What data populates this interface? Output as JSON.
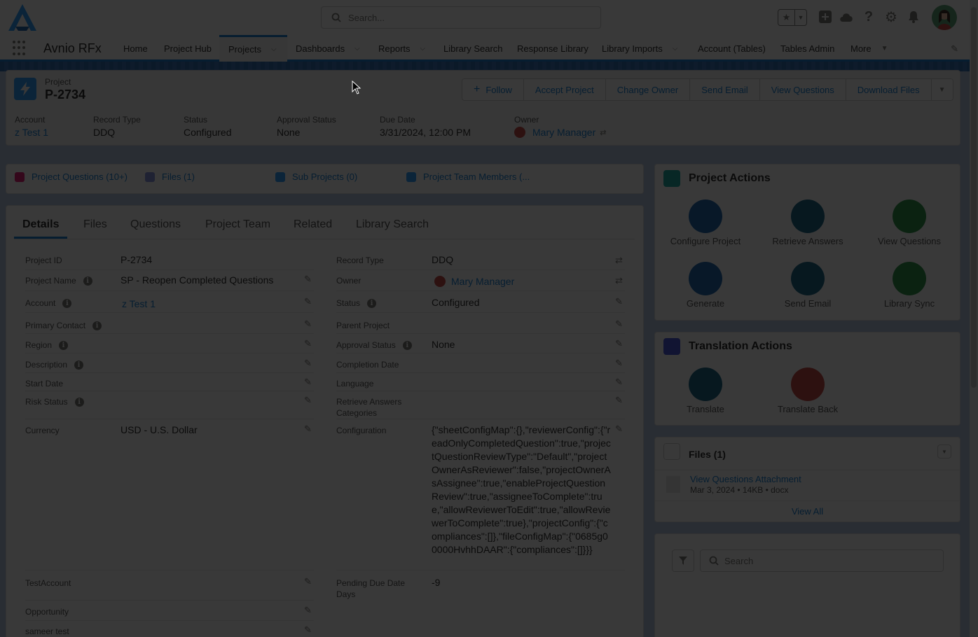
{
  "header": {
    "search_placeholder": "Search...",
    "app_name": "Avnio RFx"
  },
  "nav": {
    "items": [
      {
        "label": "Home"
      },
      {
        "label": "Project Hub"
      },
      {
        "label": "Projects",
        "active": true,
        "dropdown": true
      },
      {
        "label": "Dashboards",
        "dropdown": true
      },
      {
        "label": "Reports",
        "dropdown": true
      },
      {
        "label": "Library Search"
      },
      {
        "label": "Response Library"
      },
      {
        "label": "Library Imports",
        "dropdown": true
      },
      {
        "label": "Account (Tables)"
      },
      {
        "label": "Tables Admin"
      },
      {
        "label": "More",
        "dropdown": true
      }
    ]
  },
  "record": {
    "type_label": "Project",
    "name": "P-2734",
    "buttons": [
      "Follow",
      "Accept Project",
      "Change Owner",
      "Send Email",
      "View Questions",
      "Download Files"
    ],
    "highlights": [
      {
        "label": "Account",
        "value": "z Test 1"
      },
      {
        "label": "Record Type",
        "value": "DDQ"
      },
      {
        "label": "Status",
        "value": "Configured"
      },
      {
        "label": "Approval Status",
        "value": "None"
      },
      {
        "label": "Due Date",
        "value": "3/31/2024, 12:00 PM"
      },
      {
        "label": "Owner",
        "value": "Mary Manager"
      }
    ]
  },
  "quick_links": [
    {
      "label": "Project Questions (10+)",
      "color": "#e3066a"
    },
    {
      "label": "Files (1)",
      "color": "#7f8de1"
    },
    {
      "label": "Sub Projects (0)",
      "color": "#1b96ff"
    },
    {
      "label": "Project Team Members (...",
      "color": "#1b96ff"
    }
  ],
  "tabs": [
    "Details",
    "Files",
    "Questions",
    "Project Team",
    "Related",
    "Library Search"
  ],
  "fields_left": [
    {
      "label": "Project ID",
      "value": "P-2734",
      "info": false,
      "editable": false
    },
    {
      "label": "Project Name",
      "value": "SP - Reopen Completed Questions",
      "info": true,
      "editable": true
    },
    {
      "label": "Account",
      "value": "z Test 1",
      "info": true,
      "editable": true,
      "link": true
    },
    {
      "label": "Primary Contact",
      "value": "",
      "info": true,
      "editable": true
    },
    {
      "label": "Region",
      "value": "",
      "info": true,
      "editable": true
    },
    {
      "label": "Description",
      "value": "",
      "info": true,
      "editable": true
    },
    {
      "label": "Start Date",
      "value": "",
      "info": false,
      "editable": true
    },
    {
      "label": "Risk Status",
      "value": "",
      "info": true,
      "editable": true
    },
    {
      "label": "Currency",
      "value": "USD - U.S. Dollar",
      "info": false,
      "editable": true
    },
    {
      "label": "TestAccount",
      "value": "",
      "info": false,
      "editable": true
    },
    {
      "label": "Opportunity",
      "value": "",
      "info": false,
      "editable": true
    },
    {
      "label": "sameer test",
      "value": "",
      "info": false,
      "editable": true
    }
  ],
  "fields_right": [
    {
      "label": "Record Type",
      "value": "DDQ",
      "info": false
    },
    {
      "label": "Owner",
      "value": "Mary Manager",
      "info": false,
      "link": true
    },
    {
      "label": "Status",
      "value": "Configured",
      "info": true
    },
    {
      "label": "Parent Project",
      "value": "",
      "info": false
    },
    {
      "label": "Approval Status",
      "value": "None",
      "info": true
    },
    {
      "label": "Completion Date",
      "value": "",
      "info": false
    },
    {
      "label": "Language",
      "value": "",
      "info": false
    },
    {
      "label": "Retrieve Answers Categories",
      "value": "",
      "info": false
    },
    {
      "label": "Configuration",
      "value": "{\"sheetConfigMap\":{},\"reviewerConfig\":{\"readOnlyCompletedQuestion\":true,\"projectQuestionReviewType\":\"Default\",\"projectOwnerAsReviewer\":false,\"projectOwnerAsAssignee\":true,\"enableProjectQuestionReview\":true,\"assigneeToComplete\":true,\"allowReviewerToEdit\":true,\"allowReviewerToComplete\":true},\"projectConfig\":{\"compliances\":[]},\"fileConfigMap\":{\"0685g00000HvhhDAAR\":{\"compliances\":[]}}}",
      "info": false
    },
    {
      "label": "Pending Due Date Days",
      "value": "-9",
      "info": false
    }
  ],
  "project_actions": {
    "title": "Project Actions",
    "items": [
      {
        "label": "Configure Project",
        "color": "#0b5cab"
      },
      {
        "label": "Retrieve Answers",
        "color": "#065a7f"
      },
      {
        "label": "View Questions",
        "color": "#1b8a3a"
      },
      {
        "label": "Generate",
        "color": "#0b5cab"
      },
      {
        "label": "Send Email",
        "color": "#065a7f"
      },
      {
        "label": "Library Sync",
        "color": "#1b8a3a"
      }
    ]
  },
  "translation_actions": {
    "title": "Translation Actions",
    "items": [
      {
        "label": "Translate",
        "color": "#065a7f"
      },
      {
        "label": "Translate Back",
        "color": "#c23934"
      }
    ]
  },
  "files_card": {
    "title": "Files (1)",
    "file_name": "View Questions Attachment",
    "file_meta": "Mar 3, 2024 • 14KB • docx",
    "view_all": "View All"
  },
  "filter_card": {
    "search_placeholder": "Search"
  },
  "colors": {
    "brand": "#0176d3",
    "overlay": "rgba(8,7,7,0.8)"
  }
}
